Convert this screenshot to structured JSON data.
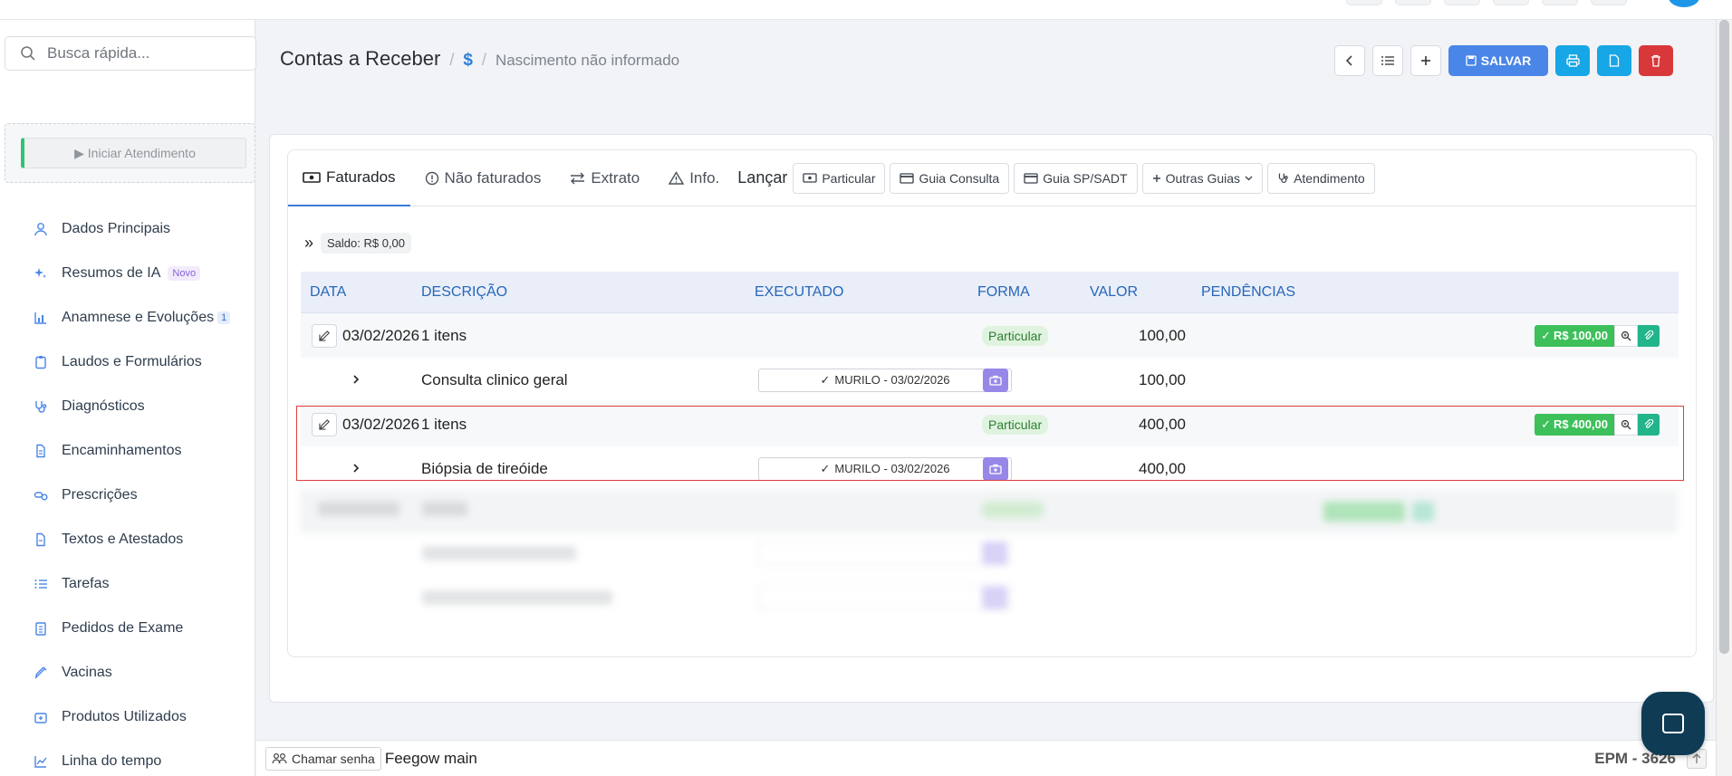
{
  "search": {
    "placeholder": "Busca rápida..."
  },
  "sidebar": {
    "start_button": "▶ Iniciar Atendimento",
    "items": [
      {
        "label": "Dados Principais",
        "icon": "user-icon"
      },
      {
        "label": "Resumos de IA",
        "icon": "sparkle-icon",
        "badge": "Novo"
      },
      {
        "label": "Anamnese e Evoluções",
        "icon": "chart-icon",
        "count": "1"
      },
      {
        "label": "Laudos e Formulários",
        "icon": "clipboard-icon"
      },
      {
        "label": "Diagnósticos",
        "icon": "stethoscope-icon"
      },
      {
        "label": "Encaminhamentos",
        "icon": "document-icon"
      },
      {
        "label": "Prescrições",
        "icon": "pills-icon"
      },
      {
        "label": "Textos e Atestados",
        "icon": "file-text-icon"
      },
      {
        "label": "Tarefas",
        "icon": "list-check-icon"
      },
      {
        "label": "Pedidos de Exame",
        "icon": "flask-icon"
      },
      {
        "label": "Vacinas",
        "icon": "syringe-icon"
      },
      {
        "label": "Produtos Utilizados",
        "icon": "box-icon"
      },
      {
        "label": "Linha do tempo",
        "icon": "timeline-icon"
      }
    ]
  },
  "header": {
    "title": "Contas a Receber",
    "separator": "/",
    "dollar": "$",
    "subtitle": "Nascimento não informado",
    "save_label": "SALVAR"
  },
  "tabs": {
    "faturados": "Faturados",
    "nao_faturados": "Não faturados",
    "extrato": "Extrato",
    "info": "Info.",
    "lancar": "Lançar",
    "buttons": [
      "Particular",
      "Guia Consulta",
      "Guia SP/SADT",
      "Outras Guias",
      "Atendimento"
    ]
  },
  "saldo": "Saldo: R$ 0,00",
  "table": {
    "headers": [
      "DATA",
      "DESCRIÇÃO",
      "EXECUTADO",
      "FORMA",
      "VALOR",
      "PENDÊNCIAS"
    ],
    "groups": [
      {
        "date": "03/02/2026",
        "desc": "1 itens",
        "forma": "Particular",
        "valor": "100,00",
        "pend": "R$ 100,00",
        "item": {
          "desc": "Consulta clinico geral",
          "executado": "MURILO - 03/02/2026",
          "valor": "100,00"
        }
      },
      {
        "date": "03/02/2026",
        "desc": "1 itens",
        "forma": "Particular",
        "valor": "400,00",
        "pend": "R$ 400,00",
        "item": {
          "desc": "Biópsia de tireóide",
          "executado": "MURILO - 03/02/2026",
          "valor": "400,00"
        }
      }
    ]
  },
  "footer": {
    "chamar": "Chamar senha",
    "env": "Feegow main",
    "epm": "EPM - 3626"
  },
  "colors": {
    "accent": "#4a86e8",
    "success": "#3dc05a",
    "danger": "#d9383a",
    "highlight": "#e23b3b"
  }
}
